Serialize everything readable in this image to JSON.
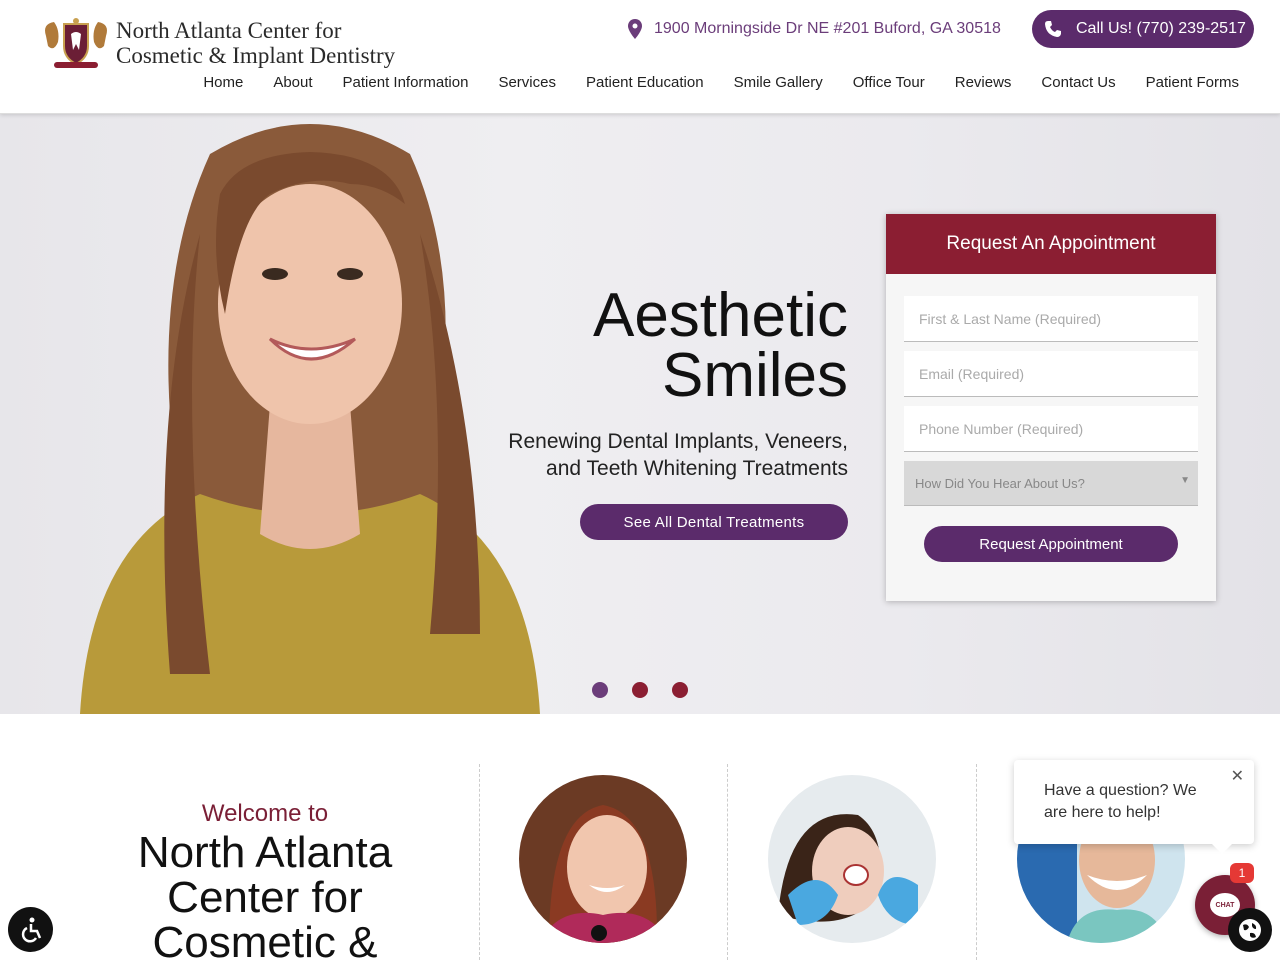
{
  "header": {
    "logo_line1": "North Atlanta Center for",
    "logo_line2": "Cosmetic & Implant Dentistry",
    "address": "1900 Morningside Dr NE #201 Buford, GA 30518",
    "call_label": "Call Us! (770) 239-2517",
    "nav": [
      "Home",
      "About",
      "Patient Information",
      "Services",
      "Patient Education",
      "Smile Gallery",
      "Office Tour",
      "Reviews",
      "Contact Us",
      "Patient Forms"
    ]
  },
  "hero": {
    "title_line1": "Aesthetic",
    "title_line2": "Smiles",
    "sub_line1": "Renewing Dental Implants, Veneers,",
    "sub_line2": "and Teeth Whitening Treatments",
    "button": "See All Dental Treatments",
    "slide_count": 3,
    "active_slide": 1
  },
  "form": {
    "title": "Request An Appointment",
    "name_placeholder": "First & Last Name (Required)",
    "email_placeholder": "Email (Required)",
    "phone_placeholder": "Phone Number (Required)",
    "source_selected": "How Did You Hear About Us?",
    "submit": "Request Appointment"
  },
  "welcome": {
    "small": "Welcome to",
    "big_line1": "North Atlanta",
    "big_line2": "Center for",
    "big_line3": "Cosmetic &"
  },
  "chat": {
    "message": "Have a question? We are here to help!",
    "close": "✕",
    "button_label": "CHAT",
    "badge": "1"
  },
  "colors": {
    "purple": "#5b2b6b",
    "maroon": "#8b1e32"
  },
  "icons": [
    "location-pin-icon",
    "phone-icon",
    "accessibility-icon",
    "globe-icon",
    "chat-icon",
    "close-icon"
  ]
}
